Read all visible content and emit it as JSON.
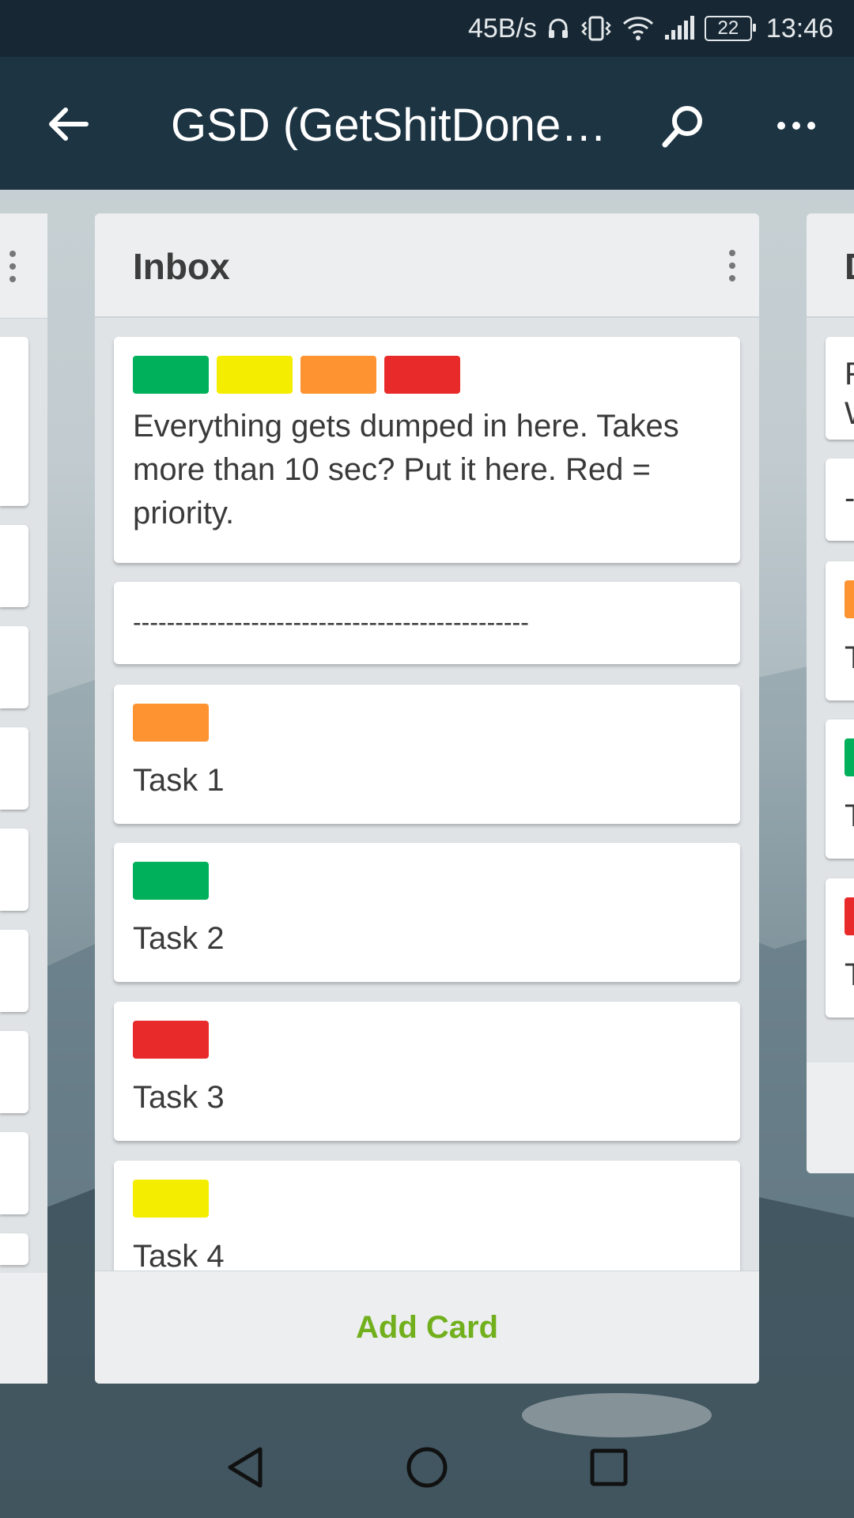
{
  "status_bar": {
    "network_speed": "45B/s",
    "battery_level": "22",
    "time": "13:46",
    "icons": [
      "headset-icon",
      "vibrate-icon",
      "wifi-icon",
      "signal-icon",
      "battery-icon"
    ]
  },
  "app_bar": {
    "title": "GSD (GetShitDone) ...",
    "back_icon": "arrow-left-icon",
    "search_icon": "search-icon",
    "more_icon": "more-horizontal-icon"
  },
  "left_list": {
    "visible": "partial"
  },
  "main_list": {
    "title": "Inbox",
    "menu_icon": "more-vertical-icon",
    "cards": [
      {
        "labels": [
          "#00b05a",
          "#f5ed00",
          "#fe9332",
          "#e82a2a"
        ],
        "text": "Everything gets dumped in here. Takes more than 10 sec? Put it here. Red = priority."
      },
      {
        "labels": [],
        "text": "-----------------------------------------------"
      },
      {
        "labels": [
          "#fe9332"
        ],
        "text": "Task 1"
      },
      {
        "labels": [
          "#00b05a"
        ],
        "text": "Task 2"
      },
      {
        "labels": [
          "#e82a2a"
        ],
        "text": "Task 3"
      },
      {
        "labels": [
          "#f5ed00"
        ],
        "text": "Task 4"
      }
    ],
    "add_card_label": "Add Card"
  },
  "right_list": {
    "title_fragment": "D",
    "cards": [
      {
        "text": "F\nW"
      },
      {
        "text": "-"
      },
      {
        "label": "#fe9332",
        "text": "T"
      },
      {
        "label": "#00b05a",
        "text": "T"
      },
      {
        "label": "#e82a2a",
        "text": "T"
      }
    ]
  },
  "nav_bar": {
    "icons": [
      "back-triangle-icon",
      "home-circle-icon",
      "recents-square-icon"
    ]
  },
  "colors": {
    "app_bar": "#1d3443",
    "status_bar": "#172834",
    "add_card_text": "#71b01c",
    "green_label": "#00b05a",
    "yellow_label": "#f5ed00",
    "orange_label": "#fe9332",
    "red_label": "#e82a2a"
  }
}
